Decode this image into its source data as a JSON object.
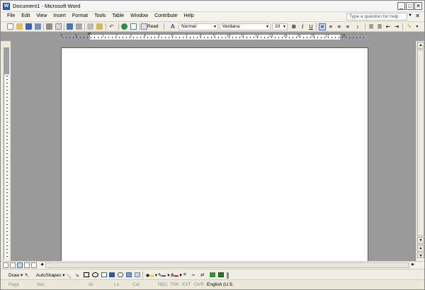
{
  "window": {
    "title": "Document1 - Microsoft Word"
  },
  "menu": {
    "items": [
      "File",
      "Edit",
      "View",
      "Insert",
      "Format",
      "Tools",
      "Table",
      "Window",
      "Contribute",
      "Help"
    ],
    "help_placeholder": "Type a question for help"
  },
  "toolbar": {
    "read_label": "Read",
    "style": "Normal",
    "font": "Verdana",
    "size": "10",
    "bold": "B",
    "italic": "I",
    "underline": "U"
  },
  "ruler": {
    "numbers": [
      "2",
      "1",
      "1",
      "2",
      "3",
      "4",
      "5",
      "6",
      "7",
      "8",
      "9",
      "10",
      "11",
      "12",
      "13",
      "14",
      "15",
      "16",
      "17",
      "18"
    ]
  },
  "drawbar": {
    "draw": "Draw",
    "autoshapes": "AutoShapes"
  },
  "status": {
    "page": "Page",
    "sec": "Sec",
    "at": "At",
    "ln": "Ln",
    "col": "Col",
    "rec": "REC",
    "trk": "TRK",
    "ext": "EXT",
    "ovr": "OVR",
    "language": "English (U.S."
  },
  "colors": {
    "fill": "#f2c31a",
    "line": "#2c58c8",
    "font": "#e02020",
    "shadow": "#2d9a2d"
  }
}
